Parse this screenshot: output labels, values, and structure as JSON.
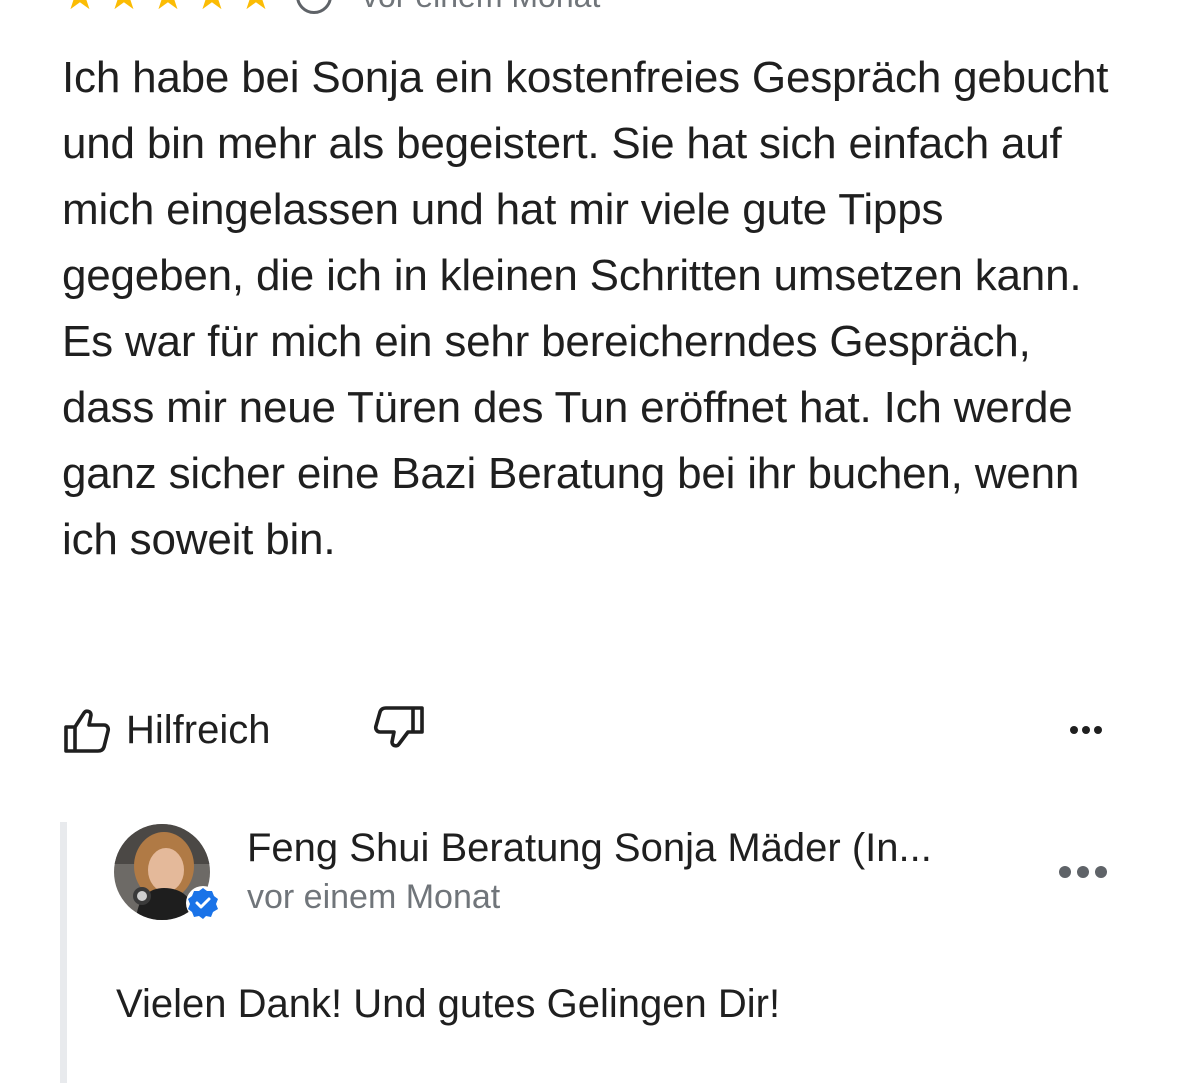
{
  "review": {
    "rating": 5,
    "rating_max": 5,
    "time": "vor einem Monat",
    "text": "Ich habe bei Sonja ein kostenfreies Gespräch gebucht und bin mehr als begeistert. Sie hat sich einfach auf mich eingelassen und hat mir viele gute Tipps gegeben, die ich in kleinen Schritten umsetzen kann. Es war für mich ein sehr bereicherndes Gespräch, dass mir neue Türen des Tun eröffnet hat. Ich werde ganz sicher eine Bazi Beratung bei ihr buchen, wenn ich soweit bin."
  },
  "actions": {
    "helpful_label": "Hilfreich",
    "like_icon": "thumb-up-icon",
    "dislike_icon": "thumb-down-icon",
    "more_icon": "more-horizontal-icon"
  },
  "owner_reply": {
    "name": "Feng Shui Beratung Sonja Mäder (In...",
    "time": "vor einem Monat",
    "text": "Vielen Dank! Und gutes Gelingen Dir!",
    "verified_icon": "verified-badge-icon"
  },
  "colors": {
    "star": "#fbbc04",
    "text": "#1f1f1f",
    "secondary_text": "#70757a",
    "verified": "#1a73e8",
    "reply_bar": "#e8eaed"
  }
}
